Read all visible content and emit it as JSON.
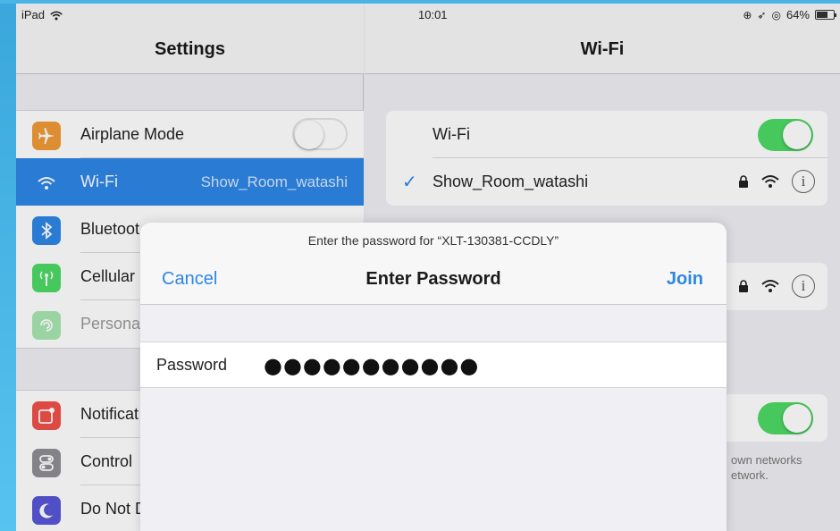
{
  "status_bar": {
    "carrier": "iPad",
    "time": "10:01",
    "battery": "64%"
  },
  "settings": {
    "title": "Settings",
    "group1": [
      {
        "label": "Airplane Mode",
        "icon": "airplane-icon",
        "color": "#f09a37",
        "toggle": "off"
      },
      {
        "label": "Wi-Fi",
        "icon": "wifi-icon",
        "color": "#2d86e6",
        "value": "Show_Room_watashi",
        "selected": true
      },
      {
        "label": "Bluetoot",
        "icon": "bluetooth-icon",
        "color": "#2d86e6"
      },
      {
        "label": "Cellular",
        "icon": "cellular-icon",
        "color": "#4cd964"
      },
      {
        "label": "Persona",
        "icon": "hotspot-icon",
        "color": "#4cd964",
        "dimmed": true
      }
    ],
    "group2": [
      {
        "label": "Notificat",
        "icon": "notifications-icon",
        "color": "#f0514a"
      },
      {
        "label": "Control",
        "icon": "control-center-icon",
        "color": "#8e8e93"
      },
      {
        "label": "Do Not D",
        "icon": "moon-icon",
        "color": "#5856d6"
      }
    ]
  },
  "wifi": {
    "title": "Wi-Fi",
    "toggle_label": "Wi-Fi",
    "toggle_state": "on",
    "connected_network": "Show_Room_watashi",
    "footer_line1": "own networks",
    "footer_line2": "etwork."
  },
  "modal": {
    "prompt": "Enter the password for “XLT-130381-CCDLY”",
    "title": "Enter Password",
    "cancel": "Cancel",
    "join": "Join",
    "password_label": "Password",
    "password_value": "●●●●●●●●●●●"
  }
}
